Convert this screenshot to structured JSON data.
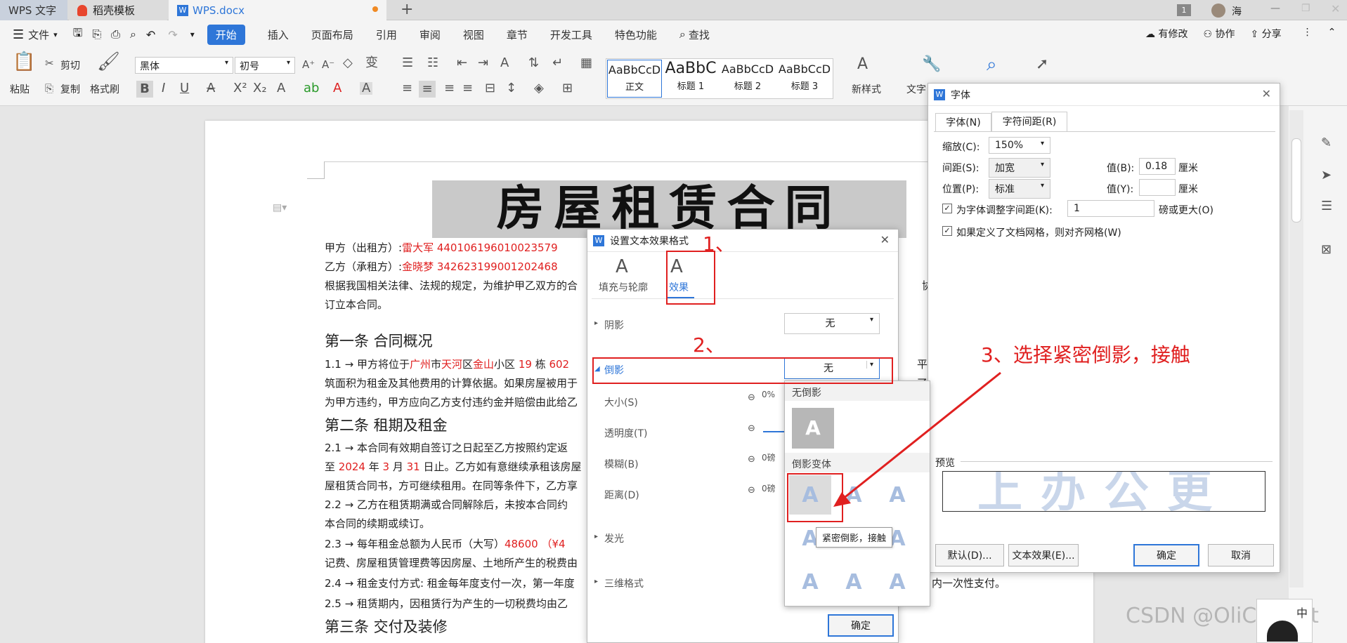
{
  "titlebar": {
    "tabs": [
      {
        "label": "WPS 文字"
      },
      {
        "label": "稻壳模板"
      },
      {
        "label": "WPS.docx"
      }
    ],
    "new_tab": "+",
    "badge": "1",
    "user": "海"
  },
  "menubar": {
    "file": "文件",
    "tabs": [
      "开始",
      "插入",
      "页面布局",
      "引用",
      "审阅",
      "视图",
      "章节",
      "开发工具",
      "特色功能"
    ],
    "search": "查找",
    "right": [
      "有修改",
      "协作",
      "分享"
    ]
  },
  "ribbon": {
    "paste": "粘贴",
    "cut": "剪切",
    "copy": "复制",
    "format_painter": "格式刷",
    "font_name": "黑体",
    "font_size": "初号",
    "styles": [
      {
        "preview": "AaBbCcD",
        "label": "正文"
      },
      {
        "preview": "AaBbC",
        "label": "标题 1"
      },
      {
        "preview": "AaBbCcD",
        "label": "标题 2"
      },
      {
        "preview": "AaBbCcD",
        "label": "标题 3"
      }
    ],
    "new_style": "新样式",
    "text_tool": "文字"
  },
  "document": {
    "title": "房屋租赁合同",
    "lines": [
      {
        "pre": "甲方（出租方）:",
        "red": "雷大军 440106196010023579"
      },
      {
        "pre": "乙方（承租方）:",
        "red": "金晓梦 342623199001202468"
      }
    ],
    "para1": "根据我国相关法律、法规的规定，为维护甲乙双方的合",
    "para1_tail": "协商，",
    "para1b": "订立本合同。",
    "sec1": "第一条 合同概况",
    "s11_pre": "1.1 → 甲方将位于",
    "s11_red1": "广州",
    "s11_mid1": "市",
    "s11_red2": "天河",
    "s11_mid2": "区",
    "s11_red3": "金山",
    "s11_mid3": "小区 ",
    "s11_red4": "19",
    "s11_mid4": " 栋 ",
    "s11_red5": "602",
    "s11_tail": "平面图",
    "s11b": "筑面积为租金及其他费用的计算依据。如果房屋被用于",
    "s11b_tail": "了交",
    "s11c": "为甲方违约，甲方应向乙方支付违约金并赔偿由此给乙",
    "sec2": "第二条 租期及租金",
    "s21": "2.1 → 本合同有效期自签订之日起至乙方按照约定返",
    "s21b_pre": "至 ",
    "s21b_r1": "2024",
    "s21b_m1": " 年 ",
    "s21b_r2": "3",
    "s21b_m2": " 月 ",
    "s21b_r3": "31",
    "s21b_tail": " 日止。乙方如有意继续承租该房屋",
    "s21c": "屋租赁合同书，方可继续租用。在同等条件下，乙方享",
    "s22": "2.2 → 乙方在租赁期满或合同解除后，未按本合同约",
    "s22b": "本合同的续期或续订。",
    "s23_pre": "2.3 → 每年租金总额为人民币（大写）",
    "s23_red": "48600 （¥4",
    "s23b": "记费、房屋租赁管理费等因房屋、土地所产生的税费由",
    "s24": "2.4 → 租金支付方式: 租金每年度支付一次，第一年度",
    "s24_tail": "内一次性支付。",
    "s25": "2.5 → 租赁期内，因租赁行为产生的一切税费均由乙",
    "sec3": "第三条 交付及装修"
  },
  "effect_dialog": {
    "title": "设置文本效果格式",
    "tab_fill": "填充与轮廓",
    "tab_effect": "效果",
    "shadow_label": "阴影",
    "shadow_value": "无",
    "reflection_label": "倒影",
    "reflection_value": "无",
    "size_label": "大小(S)",
    "size_value": "0%",
    "transparency_label": "透明度(T)",
    "blur_label": "模糊(B)",
    "blur_value": "0磅",
    "distance_label": "距离(D)",
    "distance_value": "0磅",
    "glow_label": "发光",
    "threed_label": "三维格式",
    "ok": "确定",
    "popup_none_header": "无倒影",
    "popup_variant_header": "倒影变体",
    "tooltip": "紧密倒影，接触",
    "preview_glyph": "A"
  },
  "font_dialog": {
    "title": "字体",
    "tab_font": "字体(N)",
    "tab_spacing": "字符间距(R)",
    "scale_label": "缩放(C):",
    "scale_value": "150%",
    "spacing_label": "间距(S):",
    "spacing_value": "加宽",
    "value_b_label": "值(B):",
    "value_b": "0.18",
    "unit": "厘米",
    "position_label": "位置(P):",
    "position_value": "标准",
    "value_y_label": "值(Y):",
    "kern_label": "为字体调整字间距(K):",
    "kern_value": "1",
    "kern_tail": "磅或更大(O)",
    "grid_label": "如果定义了文档网格，则对齐网格(W)",
    "preview_label": "预览",
    "preview_text": "上办公更",
    "default_btn": "默认(D)...",
    "effect_btn": "文本效果(E)...",
    "ok": "确定",
    "cancel": "取消"
  },
  "annotations": {
    "step1": "1、",
    "step2": "2、",
    "step3": "3、选择紧密倒影，接触"
  },
  "watermark": "CSDN @OliCorrect",
  "ime": "中"
}
